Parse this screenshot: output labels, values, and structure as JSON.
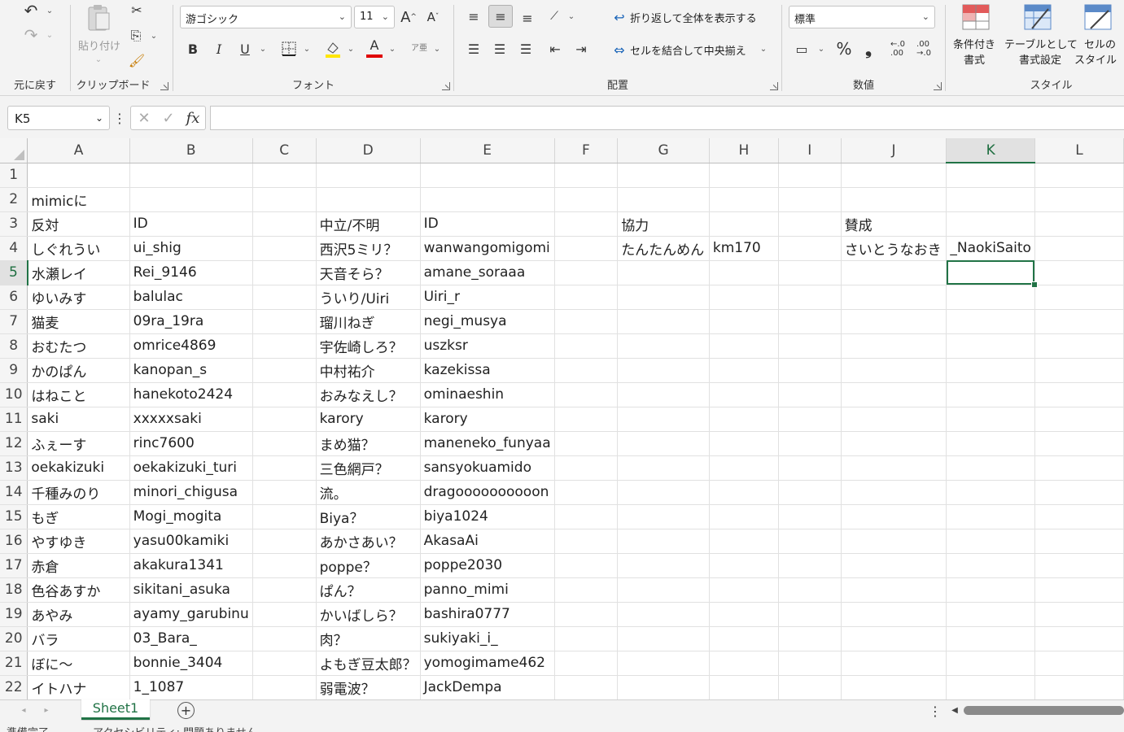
{
  "ribbon": {
    "undo_group_label": "元に戻す",
    "clipboard_group_label": "クリップボード",
    "paste_label": "貼り付け",
    "font_group_label": "フォント",
    "font_name": "游ゴシック",
    "font_size": "11",
    "bold_label": "B",
    "italic_label": "I",
    "underline_label": "U",
    "font_grow_label": "A",
    "font_shrink_label": "A",
    "font_color_label": "A",
    "phonetic_label": "ア亜",
    "alignment_group_label": "配置",
    "wrap_text_label": "折り返して全体を表示する",
    "merge_center_label": "セルを結合して中央揃え",
    "number_group_label": "数値",
    "number_format": "標準",
    "percent_label": "%",
    "comma_label": "❟",
    "styles_group_label": "スタイル",
    "cond_format_label_1": "条件付き",
    "cond_format_label_2": "書式",
    "table_format_label_1": "テーブルとして",
    "table_format_label_2": "書式設定",
    "cell_styles_label_1": "セルの",
    "cell_styles_label_2": "スタイル"
  },
  "formula_bar": {
    "name_box": "K5",
    "fx_label": "fx",
    "formula": ""
  },
  "sheet": {
    "columns": [
      "A",
      "B",
      "C",
      "D",
      "E",
      "F",
      "G",
      "H",
      "I",
      "J",
      "K",
      "L"
    ],
    "selected_column": "K",
    "selected_row": "5",
    "rows": [
      {
        "num": "1",
        "cells": [
          "",
          "",
          "",
          "",
          "",
          "",
          "",
          "",
          "",
          "",
          "",
          ""
        ]
      },
      {
        "num": "2",
        "cells": [
          "mimicに",
          "",
          "",
          "",
          "",
          "",
          "",
          "",
          "",
          "",
          "",
          ""
        ]
      },
      {
        "num": "3",
        "cells": [
          "反対",
          "ID",
          "",
          "中立/不明",
          "ID",
          "",
          "協力",
          "",
          "",
          "賛成",
          "",
          ""
        ]
      },
      {
        "num": "4",
        "cells": [
          "しぐれうい",
          "ui_shig",
          "",
          "西沢5ミリ？",
          "wanwangomigomi",
          "",
          "たんたんめん",
          "km170",
          "",
          "さいとうなおき",
          "_NaokiSaito",
          ""
        ]
      },
      {
        "num": "5",
        "cells": [
          "水瀬レイ",
          "Rei_9146",
          "",
          "天音そら？",
          "amane_soraaa",
          "",
          "",
          "",
          "",
          "",
          "",
          ""
        ]
      },
      {
        "num": "6",
        "cells": [
          "ゆいみす",
          "balulac",
          "",
          "ういり/Uiri",
          "Uiri_r",
          "",
          "",
          "",
          "",
          "",
          "",
          ""
        ]
      },
      {
        "num": "7",
        "cells": [
          "猫麦",
          "09ra_19ra",
          "",
          "瑠川ねぎ",
          "negi_musya",
          "",
          "",
          "",
          "",
          "",
          "",
          ""
        ]
      },
      {
        "num": "8",
        "cells": [
          "おむたつ",
          "omrice4869",
          "",
          "宇佐崎しろ？",
          "uszksr",
          "",
          "",
          "",
          "",
          "",
          "",
          ""
        ]
      },
      {
        "num": "9",
        "cells": [
          "かのぱん",
          "kanopan_s",
          "",
          "中村祐介",
          "kazekissa",
          "",
          "",
          "",
          "",
          "",
          "",
          ""
        ]
      },
      {
        "num": "10",
        "cells": [
          "はねこと",
          "hanekoto2424",
          "",
          "おみなえし？",
          "ominaeshin",
          "",
          "",
          "",
          "",
          "",
          "",
          ""
        ]
      },
      {
        "num": "11",
        "cells": [
          "saki",
          "xxxxxsaki",
          "",
          "karory",
          "karory",
          "",
          "",
          "",
          "",
          "",
          "",
          ""
        ]
      },
      {
        "num": "12",
        "cells": [
          "ふぇーす",
          "rinc7600",
          "",
          "まめ猫？",
          "maneneko_funyaa",
          "",
          "",
          "",
          "",
          "",
          "",
          ""
        ]
      },
      {
        "num": "13",
        "cells": [
          "oekakizuki",
          "oekakizuki_turi",
          "",
          "三色網戸？",
          "sansyokuamido",
          "",
          "",
          "",
          "",
          "",
          "",
          ""
        ]
      },
      {
        "num": "14",
        "cells": [
          "千種みのり",
          "minori_chigusa",
          "",
          "流。",
          "dragoooooooooon",
          "",
          "",
          "",
          "",
          "",
          "",
          ""
        ]
      },
      {
        "num": "15",
        "cells": [
          "もぎ",
          "Mogi_mogita",
          "",
          "Biya？",
          "biya1024",
          "",
          "",
          "",
          "",
          "",
          "",
          ""
        ]
      },
      {
        "num": "16",
        "cells": [
          "やすゆき",
          "yasu00kamiki",
          "",
          "あかさあい？",
          "AkasaAi",
          "",
          "",
          "",
          "",
          "",
          "",
          ""
        ]
      },
      {
        "num": "17",
        "cells": [
          "赤倉",
          "akakura1341",
          "",
          "poppe？",
          "poppe2030",
          "",
          "",
          "",
          "",
          "",
          "",
          ""
        ]
      },
      {
        "num": "18",
        "cells": [
          "色谷あすか",
          "sikitani_asuka",
          "",
          "ぱん？",
          "panno_mimi",
          "",
          "",
          "",
          "",
          "",
          "",
          ""
        ]
      },
      {
        "num": "19",
        "cells": [
          "あやみ",
          "ayamy_garubinu",
          "",
          "かいばしら？",
          "bashira0777",
          "",
          "",
          "",
          "",
          "",
          "",
          ""
        ]
      },
      {
        "num": "20",
        "cells": [
          "バラ",
          "03_Bara_",
          "",
          "肉？",
          "sukiyaki_i_",
          "",
          "",
          "",
          "",
          "",
          "",
          ""
        ]
      },
      {
        "num": "21",
        "cells": [
          "ぼに〜",
          "bonnie_3404",
          "",
          "よもぎ豆太郎？",
          "yomogimame462",
          "",
          "",
          "",
          "",
          "",
          "",
          ""
        ]
      },
      {
        "num": "22",
        "cells": [
          "イトハナ",
          "1_1087",
          "",
          "弱電波？",
          "JackDempa",
          "",
          "",
          "",
          "",
          "",
          "",
          ""
        ]
      }
    ]
  },
  "tabs": {
    "sheet_name": "Sheet1",
    "add_sheet": "+"
  },
  "status": {
    "ready": "準備完了",
    "accessibility": "アクセシビリティ: 問題ありません"
  },
  "colors": {
    "accent": "#217346",
    "header_bg": "#f5f5f5",
    "ribbon_bg": "#f3f3f3"
  }
}
